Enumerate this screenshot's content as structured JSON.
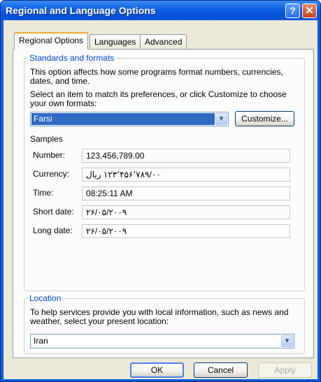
{
  "window": {
    "title": "Regional and Language Options",
    "help_button": "?",
    "close_button": "✕"
  },
  "tabs": [
    {
      "label": "Regional Options",
      "active": true
    },
    {
      "label": "Languages",
      "active": false
    },
    {
      "label": "Advanced",
      "active": false
    }
  ],
  "standards": {
    "group_title": "Standards and formats",
    "description": "This option affects how some programs format numbers, currencies, dates, and time.",
    "select_prompt": "Select an item to match its preferences, or click Customize to choose your own formats:",
    "selected_format": "Farsi",
    "customize_label": "Customize...",
    "samples_title": "Samples",
    "samples": [
      {
        "label": "Number:",
        "value": "123,456,789.00"
      },
      {
        "label": "Currency:",
        "value": "۱۲۳٬۴۵۶٬۷۸۹/۰۰ ریال"
      },
      {
        "label": "Time:",
        "value": "08:25:11 AM"
      },
      {
        "label": "Short date:",
        "value": "۲۶/۰۵/۲۰۰۹"
      },
      {
        "label": "Long date:",
        "value": "۲۶/۰۵/۲۰۰۹"
      }
    ]
  },
  "location": {
    "group_title": "Location",
    "description": "To help services provide you with local information, such as news and weather, select your present location:",
    "selected_location": "Iran"
  },
  "footer": {
    "ok_label": "OK",
    "cancel_label": "Cancel",
    "apply_label": "Apply"
  },
  "icons": {
    "dropdown_arrow": "chevron-down-icon"
  }
}
